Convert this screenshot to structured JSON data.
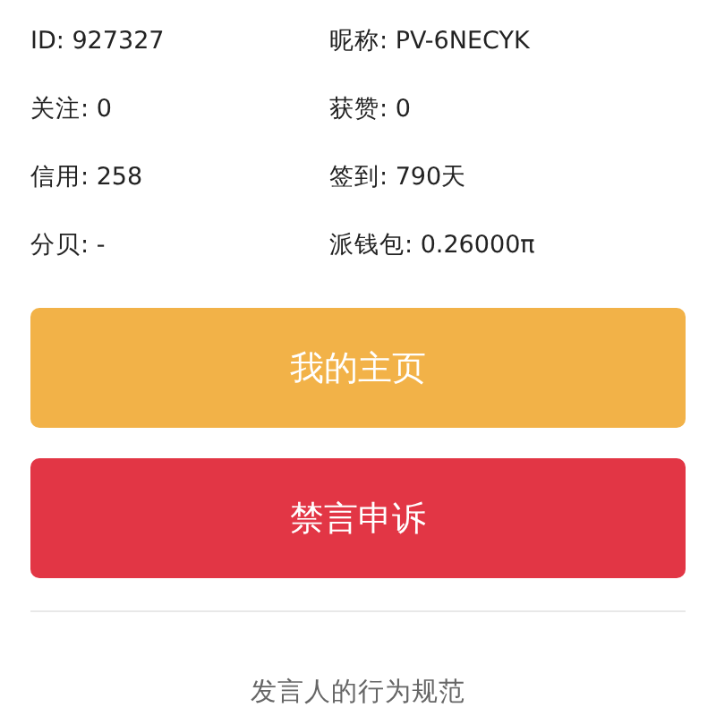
{
  "stats": [
    "ID: 927327",
    "昵称: PV-6NECYK",
    "关注: 0",
    "获赞: 0",
    "信用: 258",
    "签到: 790天",
    "分贝: -",
    "派钱包: 0.26000π"
  ],
  "buttons": [
    {
      "label": "我的主页",
      "kind": "primary"
    },
    {
      "label": "禁言申诉",
      "kind": "danger"
    }
  ],
  "footer_link": "发言人的行为规范"
}
